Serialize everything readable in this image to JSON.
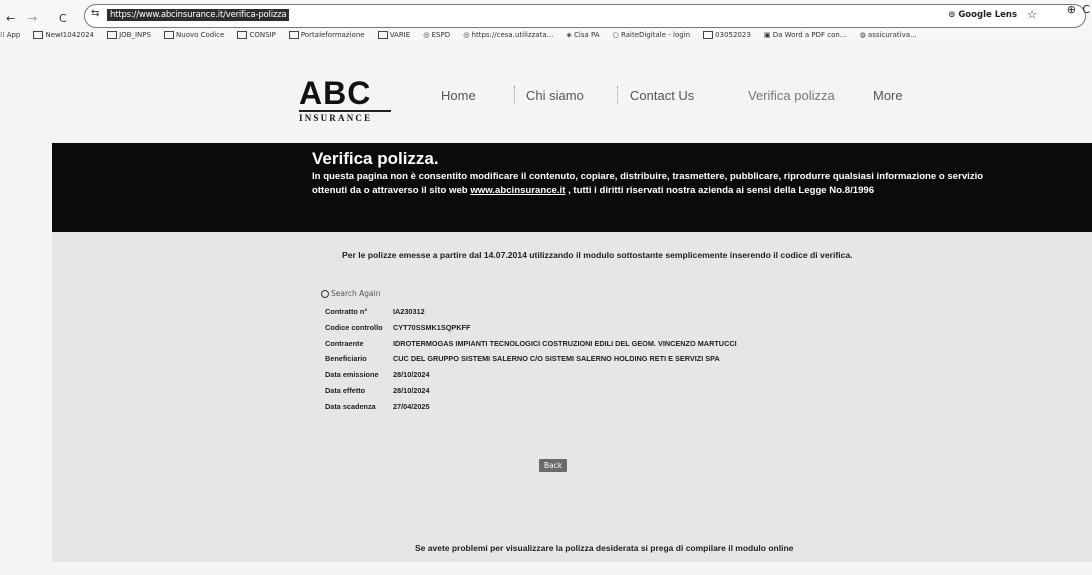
{
  "browser": {
    "back": "←",
    "forward": "→",
    "reload": "C",
    "url": "https://www.abcinsurance.it/verifica-polizza",
    "google_lens": "Google Lens",
    "bookmarks": [
      "App",
      "NewI1042024",
      "JOB_INPS",
      "Nuovo Codice",
      "CONSIP",
      "Portaleformazione",
      "VARIE",
      "ESPD",
      "https://cesa.utilizzata...",
      "Cisa PA",
      "RaiteDigitale - login",
      "03052023",
      "Da Word a PDF con...",
      "assicurativa..."
    ]
  },
  "site": {
    "logo_main": "ABC",
    "logo_sub": "INSURANCE",
    "nav": [
      "Home",
      "Chi siamo",
      "Contact Us",
      "Verifica polizza",
      "More"
    ]
  },
  "banner": {
    "title": "Verifica polizza.",
    "text_before_link": "In questa pagina non è consentito modificare il contenuto, copiare, distribuire, trasmettere, pubblicare, riprodurre qualsiasi informazione o servizio ottenuti da o attraverso il sito web ",
    "link": "www.abcinsurance.it",
    "text_after_link": " , tutti i diritti riservati nostra azienda ai sensi della Legge No.8/1996"
  },
  "content": {
    "intro": "Per le polizze emesse a partire dal 14.07.2014 utilizzando il modulo sottostante semplicemente inserendo il codice di verifica.",
    "search_placeholder": "Search Again",
    "rows": [
      {
        "label": "Contratto n°",
        "value": "IA230312"
      },
      {
        "label": "Codice controllo",
        "value": "CYT70SSMK1SQPKFF"
      },
      {
        "label": "Contraente",
        "value": "IDROTERMOGAS IMPIANTI TECNOLOGICI COSTRUZIONI EDILI DEL GEOM. VINCENZO MARTUCCI"
      },
      {
        "label": "Beneficiario",
        "value": "CUC DEL GRUPPO SISTEMI SALERNO C/O SISTEMI SALERNO HOLDING RETI E SERVIZI SPA"
      },
      {
        "label": "Data emissione",
        "value": "28/10/2024"
      },
      {
        "label": "Data effetto",
        "value": "28/10/2024"
      },
      {
        "label": "Data scadenza",
        "value": "27/04/2025"
      }
    ],
    "back_button": "Back",
    "footer": "Se avete problemi per visualizzare la polizza desiderata si prega di compilare il modulo online"
  }
}
